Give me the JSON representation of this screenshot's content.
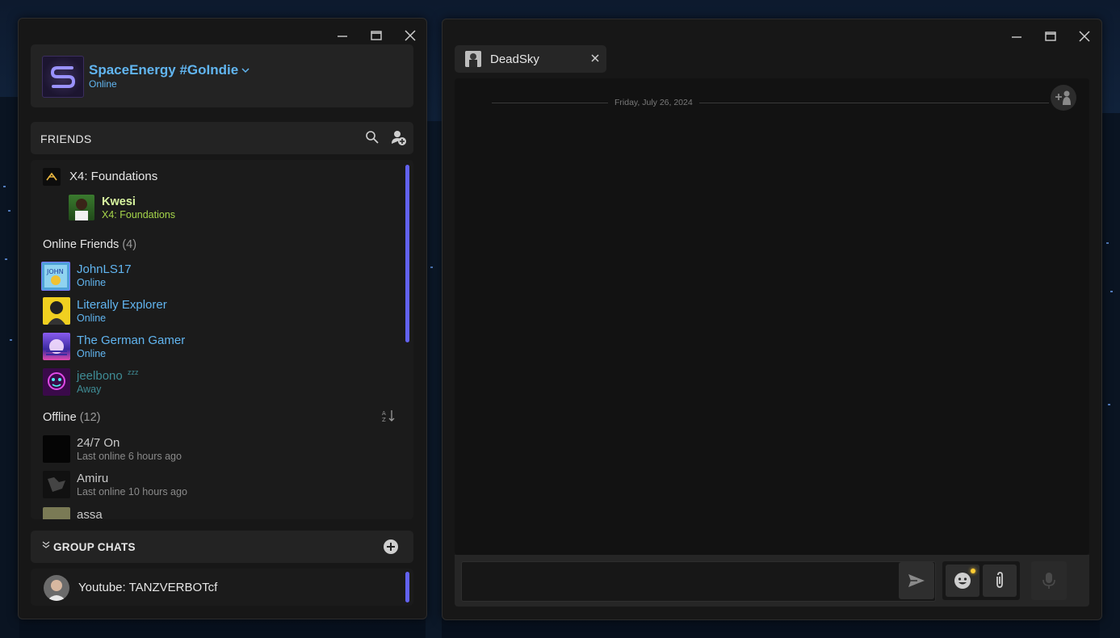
{
  "friends_window": {
    "profile": {
      "name": "SpaceEnergy #GoIndie",
      "status": "Online"
    },
    "friends_header": "FRIENDS",
    "in_game": {
      "game": "X4: Foundations",
      "players": [
        {
          "name": "Kwesi",
          "activity": "X4: Foundations"
        }
      ]
    },
    "online_section": {
      "label": "Online Friends",
      "count": "(4)"
    },
    "online": [
      {
        "name": "JohnLS17",
        "status": "Online"
      },
      {
        "name": "Literally Explorer",
        "status": "Online"
      },
      {
        "name": "The German Gamer",
        "status": "Online"
      },
      {
        "name": "jeelbono",
        "status": "Away",
        "badge": "zzz"
      }
    ],
    "offline_section": {
      "label": "Offline",
      "count": "(12)"
    },
    "offline": [
      {
        "name": "24/7 On",
        "status": "Last online 6 hours ago"
      },
      {
        "name": "Amiru",
        "status": "Last online 10 hours ago"
      },
      {
        "name": "assa",
        "status": ""
      }
    ],
    "group_chats_header": "GROUP CHATS",
    "group_chats": [
      {
        "name": "Youtube: TANZVERBOTcf"
      }
    ]
  },
  "chat_window": {
    "tab": {
      "name": "DeadSky"
    },
    "date_divider": "Friday, July 26, 2024",
    "input": {
      "placeholder": ""
    }
  },
  "colors": {
    "accent_blue": "#61b5f0",
    "in_game_green": "#a6d64a",
    "away_teal": "#3f8c95",
    "scrollbar": "#6262f0",
    "notification": "#ffcc33"
  },
  "icons": [
    "minimize-icon",
    "maximize-icon",
    "close-icon",
    "chevron-down-icon",
    "search-icon",
    "add-friend-icon",
    "sort-icon",
    "expand-icon",
    "add-group-icon",
    "add-person-icon",
    "send-icon",
    "emoji-icon",
    "attachment-icon",
    "microphone-icon"
  ]
}
